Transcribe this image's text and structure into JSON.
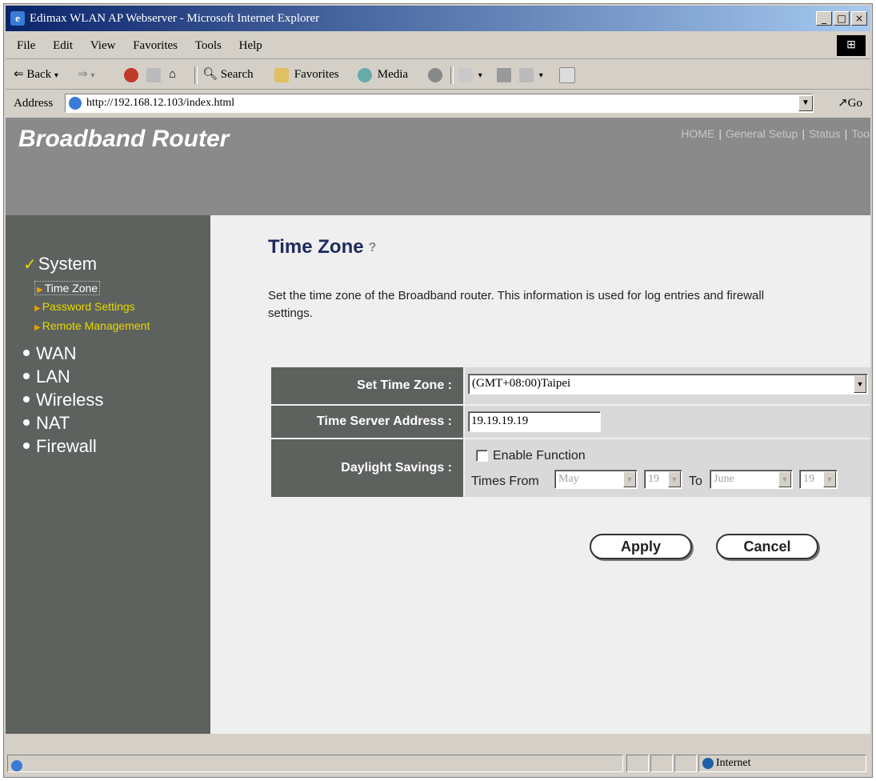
{
  "window": {
    "title": "Edimax WLAN AP Webserver - Microsoft Internet Explorer",
    "controls": [
      "_",
      "□",
      "×"
    ]
  },
  "menu": {
    "items": [
      "File",
      "Edit",
      "View",
      "Favorites",
      "Tools",
      "Help"
    ]
  },
  "toolbar": {
    "back": "Back",
    "search": "Search",
    "favorites": "Favorites",
    "media": "Media"
  },
  "address": {
    "label": "Address",
    "url": "http://192.168.12.103/index.html",
    "go": "Go"
  },
  "header": {
    "brand": "Broadband Router",
    "nav": [
      "HOME",
      "General Setup",
      "Status",
      "Tool"
    ]
  },
  "sidebar": {
    "system": "System",
    "sub": [
      "Time Zone",
      "Password Settings",
      "Remote Management"
    ],
    "items": [
      "WAN",
      "LAN",
      "Wireless",
      "NAT",
      "Firewall"
    ]
  },
  "page": {
    "title": "Time Zone",
    "description": "Set the time zone of the Broadband router. This information is used for log entries and firewall settings."
  },
  "form": {
    "timezone_label": "Set Time Zone :",
    "timezone_value": "(GMT+08:00)Taipei",
    "server_label": "Time Server Address :",
    "server_value": "19.19.19.19",
    "daylight_label": "Daylight Savings :",
    "enable_label": "Enable Function",
    "times_from": "Times From",
    "from_month": "May",
    "from_day": "19",
    "to_label": "To",
    "to_month": "June",
    "to_day": "19"
  },
  "buttons": {
    "apply": "Apply",
    "cancel": "Cancel"
  },
  "status": {
    "zone": "Internet"
  }
}
